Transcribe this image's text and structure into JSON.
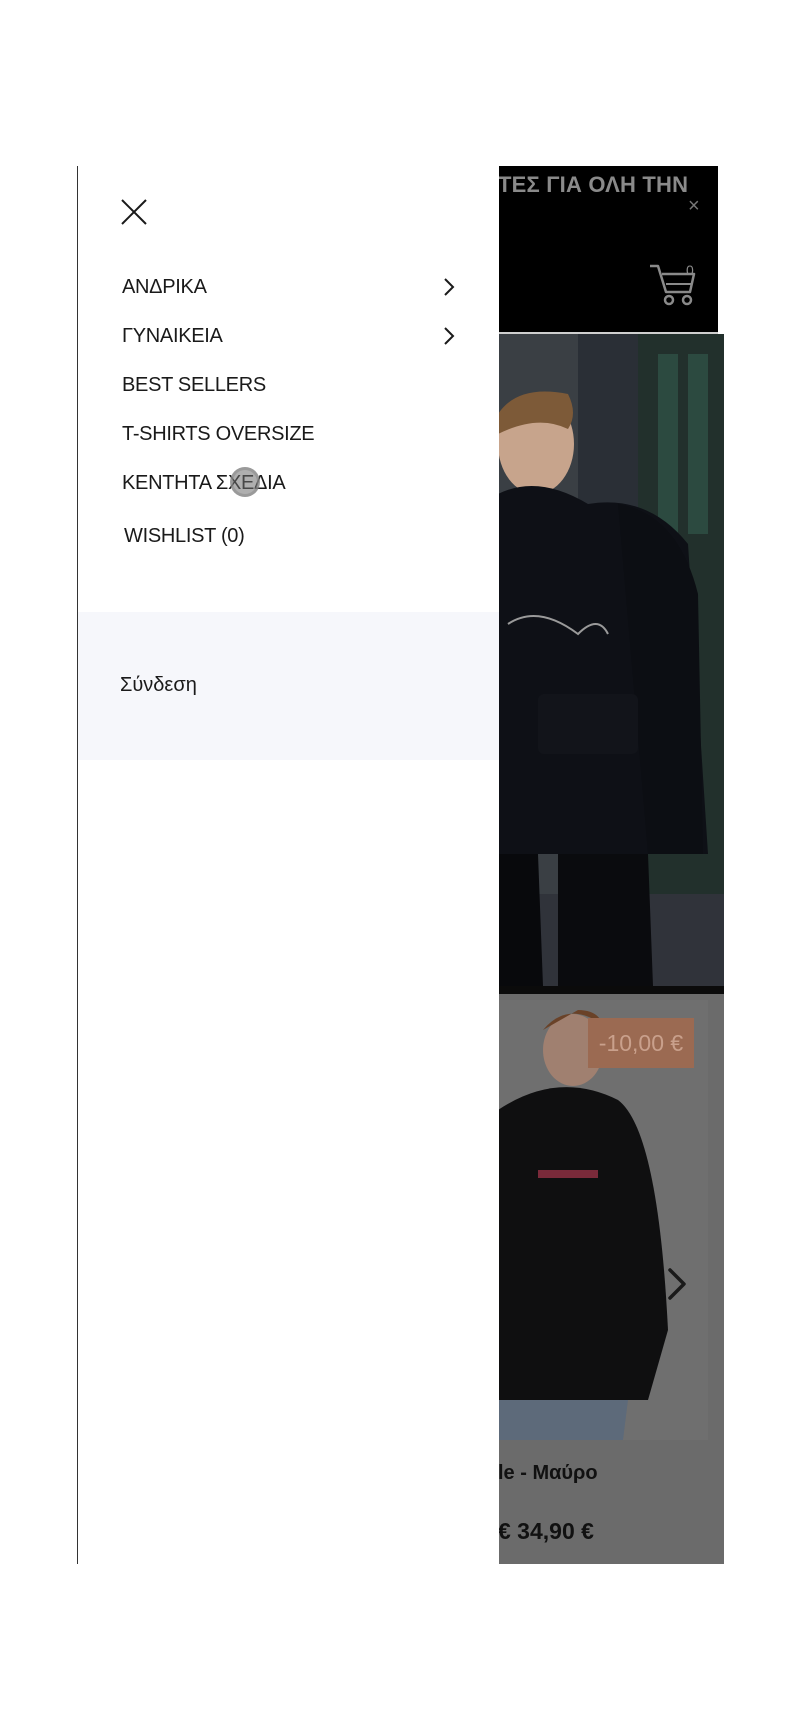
{
  "background_page": {
    "promo_text": "ΤΕΣ ΓΙΑ ΟΛΗ ΤΗΝ",
    "promo_close": "×",
    "cart_count": "0",
    "discount_badge": "-10,00 €",
    "product_name": "le - Μαύρο",
    "product_price": "€ 34,90 €"
  },
  "drawer": {
    "menu": [
      {
        "label": "ΑΝΔΡΙΚΑ",
        "has_submenu": true
      },
      {
        "label": "ΓΥΝΑΙΚΕΙΑ",
        "has_submenu": true
      },
      {
        "label": "BEST SELLERS",
        "has_submenu": false
      },
      {
        "label": "T-SHIRTS OVERSIZE",
        "has_submenu": false
      },
      {
        "label": "ΚΕΝΤΗΤΑ ΣΧΕΔΙΑ",
        "has_submenu": false
      },
      {
        "label": "WISHLIST (0)",
        "has_submenu": false
      }
    ],
    "login_label": "Σύνδεση"
  },
  "icons": {
    "close": "close-icon",
    "chevron": "chevron-right-icon",
    "cart": "cart-icon"
  },
  "colors": {
    "overlay_dark": "#000000",
    "login_panel_bg": "#f6f7fb",
    "discount_badge_bg": "#9b6a52"
  }
}
